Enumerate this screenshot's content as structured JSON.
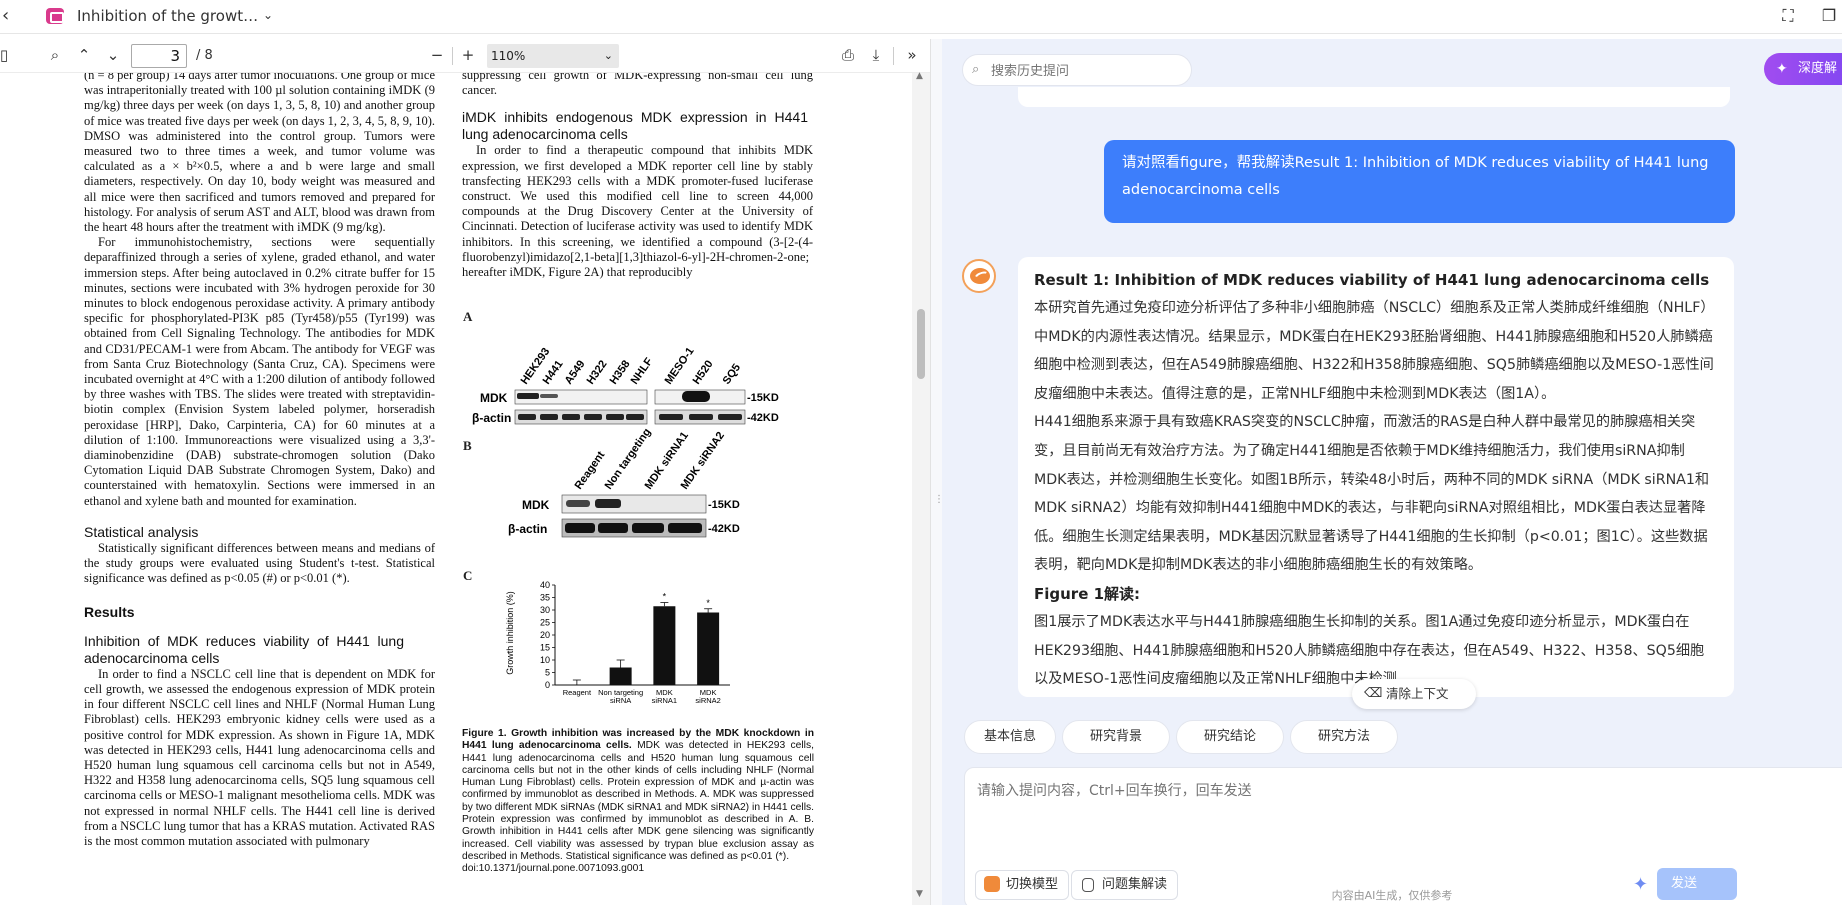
{
  "tab": {
    "title": "Inhibition of the growt…"
  },
  "pdf_toolbar": {
    "page_current": "3",
    "page_total": "/ 8",
    "zoom": "110%"
  },
  "pdf": {
    "left_col": {
      "para1": "(n = 8 per group) 14 days after tumor inoculations. One group of mice was intraperitonially treated with 100 µl solution containing iMDK (9 mg/kg) three days per week (on days 1, 3, 5, 8, 10) and another group of mice was treated five days per week (on days 1, 2, 3, 4, 5, 8, 9, 10). DMSO was administered into the control group. Tumors were measured two to three times a week, and tumor volume was calculated as a × b²×0.5, where a and b were large and small diameters, respectively. On day 10, body weight was measured and all mice were then sacrificed and tumors removed and prepared for histology. For analysis of serum AST and ALT, blood was drawn from the heart 48 hours after the treatment with iMDK (9 mg/kg).",
      "para2": "For immunohistochemistry, sections were sequentially deparaffinized through a series of xylene, graded ethanol, and water immersion steps. After being autoclaved in 0.2% citrate buffer for 15 minutes, sections were incubated with 3% hydrogen peroxide for 30 minutes to block endogenous peroxidase activity. A primary antibody specific for phosphorylated-PI3K p85 (Tyr458)/p55 (Tyr199) was obtained from Cell Signaling Technology. The antibodies for MDK and CD31/PECAM-1 were from Abcam. The antibody for VEGF was from Santa Cruz Biotechnology (Santa Cruz, CA). Specimens were incubated overnight at 4°C with a 1:200 dilution of antibody followed by three washes with TBS. The slides were treated with streptavidin-biotin complex (Envision System labeled polymer, horseradish peroxidase [HRP], Dako, Carpinteria, CA) for 60 minutes at a dilution of 1:100. Immunoreactions were visualized using a 3,3'-diaminobenzidine (DAB) substrate-chromogen solution (Dako Cytomation Liquid DAB Substrate Chromogen System, Dako) and counterstained with hematoxylin. Sections were immersed in an ethanol and xylene bath and mounted for examination.",
      "h_stat": "Statistical analysis",
      "para3": "Statistically significant differences between means and medians of the study groups were evaluated using Student's t-test. Statistical significance was defined as p<0.05 (#) or p<0.01 (*).",
      "h_results": "Results",
      "h_inhib": "Inhibition of MDK reduces viability of H441 lung adenocarcinoma cells",
      "para4": "In order to find a NSCLC cell line that is dependent on MDK for cell growth, we assessed the endogenous expression of MDK protein in four different NSCLC cell lines and NHLF (Normal Human Lung Fibroblast) cells. HEK293 embryonic kidney cells were used as a positive control for MDK expression. As shown in Figure 1A, MDK was detected in HEK293 cells, H441 lung adenocarcinoma cells and H520 human lung squamous cell carcinoma cells but not in A549, H322 and H358 lung adenocarcinoma cells, SQ5 lung squamous cell carcinoma cells or MESO-1 malignant mesothelioma cells. MDK was not expressed in normal NHLF cells. The H441 cell line is derived from a NSCLC lung tumor that has a KRAS mutation. Activated RAS is the most common mutation associated with pulmonary"
    },
    "right_col": {
      "top_text": "suppressing cell growth of MDK-expressing non-small cell lung cancer.",
      "h_imdk": "iMDK inhibits endogenous MDK expression in H441 lung adenocarcinoma cells",
      "para": "In order to find a therapeutic compound that inhibits MDK expression, we first developed a MDK reporter cell line by stably transfecting HEK293 cells with a MDK promoter-fused luciferase construct. We used this modified cell line to screen 44,000 compounds at the Drug Discovery Center at the University of Cincinnati. Detection of luciferase activity was used to identify MDK inhibitors. In this screening, we identified a compound (3-[2-(4-fluorobenzyl)imidazo[2,1-beta][1,3]thiazol-6-yl]-2H-chromen-2-one; hereafter iMDK, Figure 2A) that reproducibly"
    },
    "figure": {
      "panel_a": "A",
      "panel_b": "B",
      "panel_c": "C",
      "a_lanes_left": [
        "HEK293",
        "H441",
        "A549",
        "H322",
        "H358",
        "NHLF"
      ],
      "a_lanes_right": [
        "MESO-1",
        "H520",
        "SQ5"
      ],
      "row_mdk": "MDK",
      "row_actin": "β-actin",
      "kd15": "-15KD",
      "kd42": "-42KD",
      "b_lanes": [
        "Reagent",
        "Non targeting siRNA",
        "MDK siRNA1",
        "MDK siRNA2"
      ],
      "c_ylabel": "Growth inhibition (%)",
      "caption_title": "Figure 1. Growth inhibition was increased by the MDK knockdown in H441 lung adenocarcinoma cells.",
      "caption_body": "MDK was detected in HEK293 cells, H441 lung adenocarcinoma cells and H520 human lung squamous cell carcinoma cells but not in the other kinds of cells including NHLF (Normal Human Lung Fibroblast) cells. Protein expression of MDK and µ-actin was confirmed by immunoblot as described in Methods. A. MDK was suppressed by two different MDK siRNAs (MDK siRNA1 and MDK siRNA2) in H441 cells. Protein expression was confirmed by immunoblot as described in A. B. Growth inhibition in H441 cells after MDK gene silencing was significantly increased. Cell viability was assessed by trypan blue exclusion assay as described in Methods. Statistical significance was defined as p<0.01 (*).",
      "doi": "doi:10.1371/journal.pone.0071093.g001"
    }
  },
  "chart_data": {
    "type": "bar",
    "categories": [
      "Reagent",
      "Non targeting siRNA",
      "MDK siRNA1",
      "MDK siRNA2"
    ],
    "values": [
      0,
      7,
      31.5,
      29
    ],
    "errors": [
      2,
      3,
      1.5,
      1.5
    ],
    "significance": [
      "",
      "",
      "*",
      "*"
    ],
    "ylabel": "Growth inhibition (%)",
    "ylim": [
      0,
      40
    ],
    "yticks": [
      0,
      5,
      10,
      15,
      20,
      25,
      30,
      35,
      40
    ]
  },
  "ai": {
    "search_placeholder": "搜索历史提问",
    "deep_button": "深度解",
    "user_message": "请对照看figure，帮我解读Result 1: Inhibition of MDK reduces viability of H441 lung adenocarcinoma cells",
    "answer_title": "Result 1: Inhibition of MDK reduces viability of H441 lung adenocarcinoma cells",
    "answer_p1": "本研究首先通过免疫印迹分析评估了多种非小细胞肺癌（NSCLC）细胞系及正常人类肺成纤维细胞（NHLF）中MDK的内源性表达情况。结果显示，MDK蛋白在HEK293胚胎肾细胞、H441肺腺癌细胞和H520人肺鳞癌细胞中检测到表达，但在A549肺腺癌细胞、H322和H358肺腺癌细胞、SQ5肺鳞癌细胞以及MESO-1恶性间皮瘤细胞中未表达。值得注意的是，正常NHLF细胞中未检测到MDK表达（图1A）。",
    "answer_p2": "H441细胞系来源于具有致癌KRAS突变的NSCLC肿瘤，而激活的RAS是白种人群中最常见的肺腺癌相关突变，且目前尚无有效治疗方法。为了确定H441细胞是否依赖于MDK维持细胞活力，我们使用siRNA抑制MDK表达，并检测细胞生长变化。如图1B所示，转染48小时后，两种不同的MDK siRNA（MDK siRNA1和MDK siRNA2）均能有效抑制H441细胞中MDK的表达，与非靶向siRNA对照组相比，MDK蛋白表达显著降低。细胞生长测定结果表明，MDK基因沉默显著诱导了H441细胞的生长抑制（p<0.01；图1C）。这些数据表明，靶向MDK是抑制MDK表达的非小细胞肺癌细胞生长的有效策略。",
    "answer_sub": "Figure 1解读:",
    "answer_p3": "图1展示了MDK表达水平与H441肺腺癌细胞生长抑制的关系。图1A通过免疫印迹分析显示，MDK蛋白在HEK293细胞、H441肺腺癌细胞和H520人肺鳞癌细胞中存在表达，但在A549、H322、H358、SQ5细胞以及MESO-1恶性间皮瘤细胞以及正常NHLF细胞中未检测",
    "clear_context": "清除上下文",
    "chips": [
      "基本信息",
      "研究背景",
      "研究结论",
      "研究方法"
    ],
    "input_placeholder": "请输入提问内容，Ctrl+回车换行，回车发送",
    "switch_model": "切换模型",
    "question_set": "问题集解读",
    "send": "发送",
    "footer": "内容由AI生成，仅供参考"
  }
}
